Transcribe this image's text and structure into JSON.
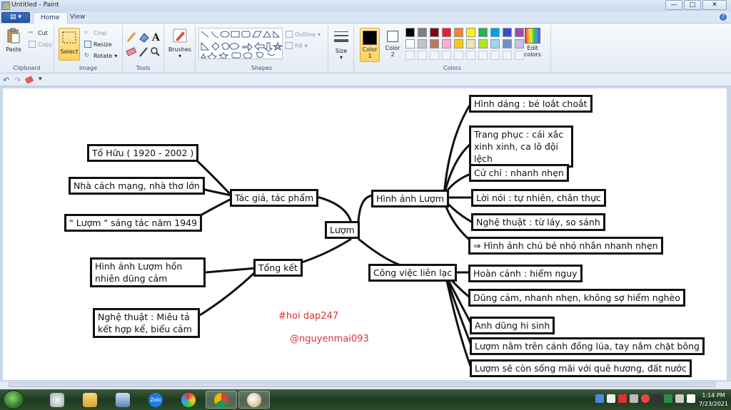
{
  "window": {
    "title": "Untitled - Paint",
    "buttons": [
      "—",
      "□",
      "✕"
    ]
  },
  "tabs": {
    "file": "▤ ▾",
    "home": "Home",
    "view": "View"
  },
  "ribbon": {
    "clipboard": {
      "label": "Clipboard",
      "paste": "Paste",
      "cut": "Cut",
      "copy": "Copy"
    },
    "image": {
      "label": "Image",
      "select": "Select",
      "crop": "Crop",
      "resize": "Resize",
      "rotate": "Rotate"
    },
    "tools": {
      "label": "Tools"
    },
    "brushes": {
      "label": "Brushes"
    },
    "shapes": {
      "label": "Shapes",
      "outline": "Outline",
      "fill": "Fill"
    },
    "size": {
      "label": "Size"
    },
    "color1": {
      "label": "Color\n1",
      "value": "#000000"
    },
    "color2": {
      "label": "Color\n2",
      "value": "#ffffff"
    },
    "colors": {
      "label": "Colors"
    },
    "edit_colors": {
      "label": "Edit\ncolors"
    },
    "palette": [
      "#000000",
      "#7f7f7f",
      "#880015",
      "#ed1c24",
      "#ff7f27",
      "#fff200",
      "#22b14c",
      "#00a2e8",
      "#3f48cc",
      "#a349a4",
      "#ffffff",
      "#c3c3c3",
      "#b97a57",
      "#ffaec9",
      "#ffc90e",
      "#efe4b0",
      "#b5e61d",
      "#99d9ea",
      "#7092be",
      "#c8bfe7"
    ]
  },
  "mindmap": {
    "center": "Lượm",
    "left_top": "Tác giả, tác phẩm",
    "left_top_children": [
      "Tố Hữu ( 1920 - 2002 )",
      "Nhà cách mạng, nhà thơ lớn",
      "\" Lượm \" sáng tác năm 1949"
    ],
    "left_bottom": "Tổng kết",
    "left_bottom_children": [
      "Hình ảnh Lượm hồn nhiên dũng cảm",
      "Nghệ thuật : Miêu tả kết hợp kể, biểu cảm"
    ],
    "right_top": "Hình ảnh Lượm",
    "right_top_children": [
      "Hình dáng : bé loắt choắt",
      "Trang phục : cái xắc xinh xinh, ca lô đội lệch",
      "Cử chỉ : nhanh nhẹn",
      "Lời nói : tự nhiên, chân thực",
      "Nghệ thuật : từ láy, so sánh",
      "⇒ Hình ảnh chú bé nhỏ nhắn nhanh nhẹn"
    ],
    "right_bottom": "Công việc liên lạc",
    "right_bottom_children": [
      "Hoàn cảnh : hiểm nguy",
      "Dũng cảm, nhanh nhẹn, không sợ hiểm nghèo",
      "Anh dũng hi sinh",
      "Lượm nằm trên cánh đồng lúa, tay nắm chặt bông",
      "Lượm sẽ còn sống mãi với quê hương, đất nước"
    ],
    "watermark1": "#hoi dap247",
    "watermark2": "@nguyenmai093"
  },
  "taskbar": {
    "time": "1:14 PM",
    "date": "7/23/2021"
  }
}
